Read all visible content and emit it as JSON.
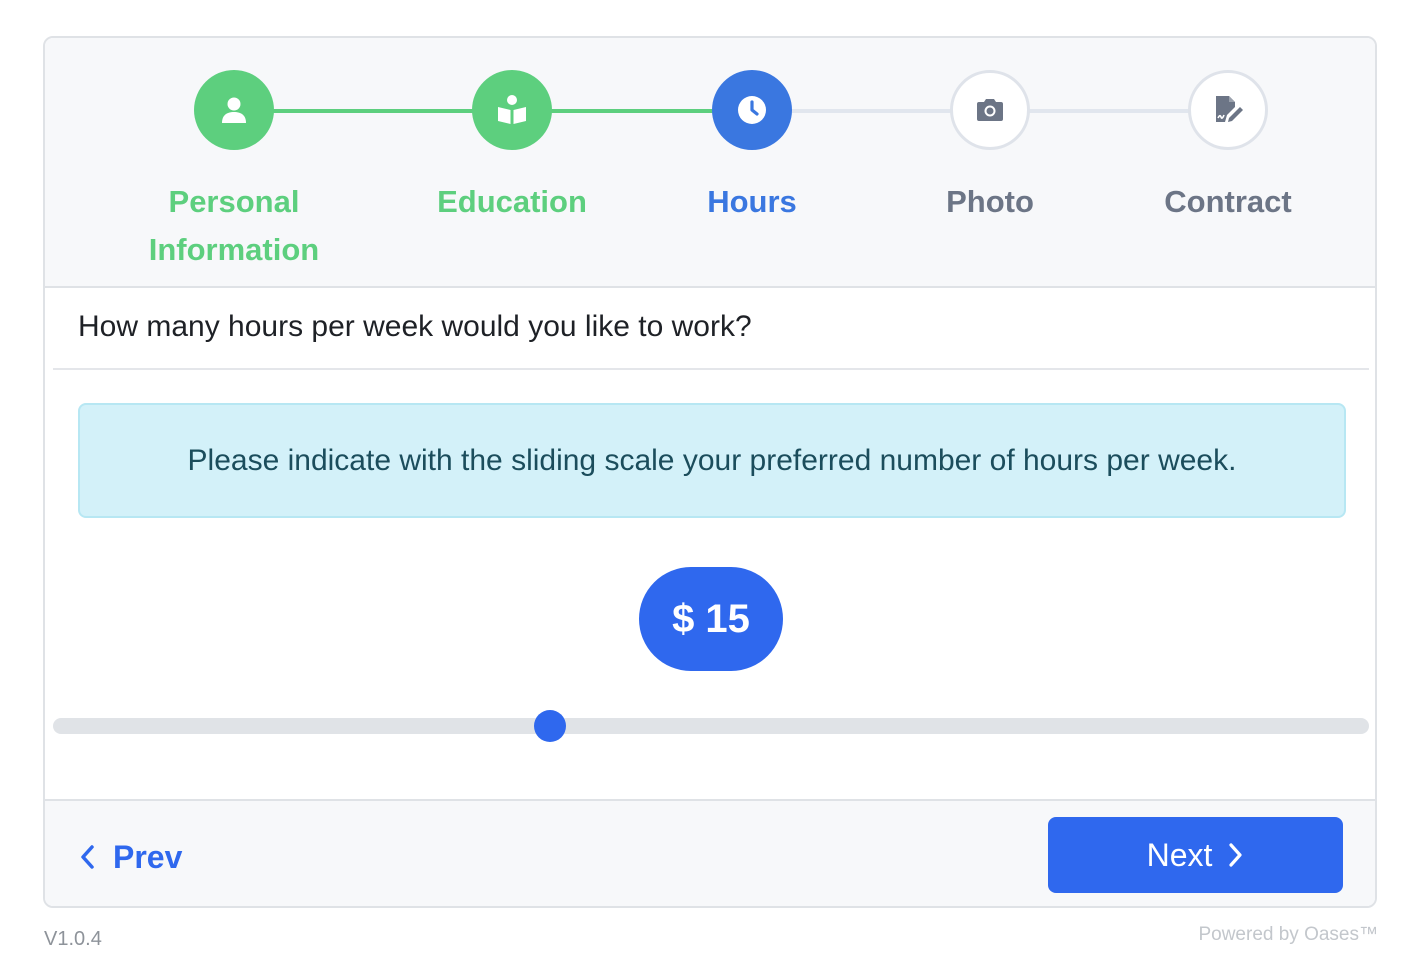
{
  "stepper": {
    "steps": [
      {
        "label": "Personal Information",
        "status": "done",
        "icon": "user-icon"
      },
      {
        "label": "Education",
        "status": "done",
        "icon": "book-reader-icon"
      },
      {
        "label": "Hours",
        "status": "active",
        "icon": "clock-icon"
      },
      {
        "label": "Photo",
        "status": "todo",
        "icon": "camera-icon"
      },
      {
        "label": "Contract",
        "status": "todo",
        "icon": "signature-icon"
      }
    ]
  },
  "question": {
    "text": "How many hours per week would you like to work?"
  },
  "info": {
    "text": "Please indicate with the sliding scale your preferred number of hours per week."
  },
  "slider": {
    "value_label": "$ 15",
    "position_fraction": 0.378
  },
  "footer": {
    "prev_label": "Prev",
    "next_label": "Next"
  },
  "meta": {
    "version": "V1.0.4",
    "powered_by": "Powered by Oases™"
  },
  "colors": {
    "done": "#5dcf7e",
    "active": "#3a77e0",
    "primary": "#2f68ee",
    "info_bg": "#d3f1f9"
  }
}
